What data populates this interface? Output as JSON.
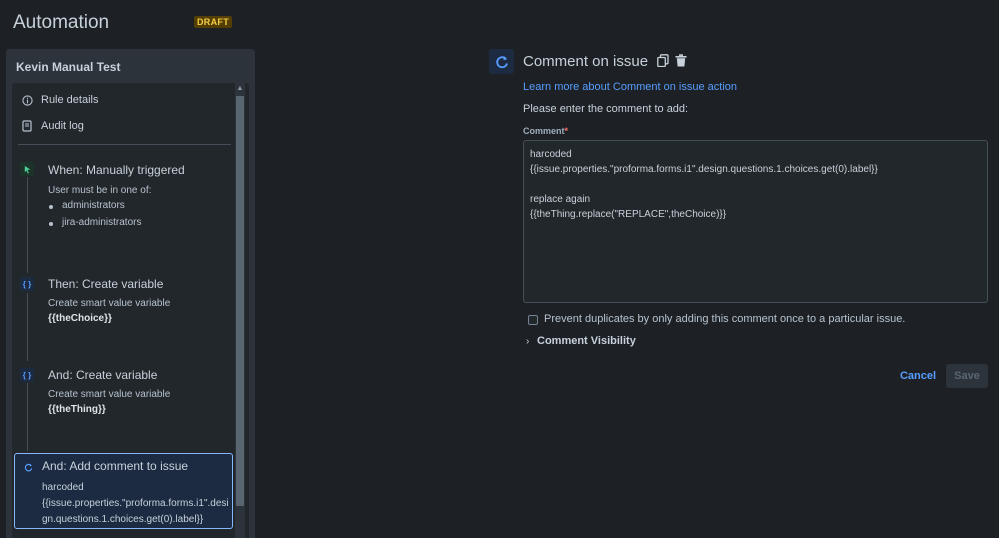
{
  "header": {
    "title": "Automation",
    "badge": "DRAFT"
  },
  "sidebar": {
    "rule_name": "Kevin Manual Test",
    "menu": [
      {
        "label": "Rule details",
        "icon": "info-icon"
      },
      {
        "label": "Audit log",
        "icon": "document-icon"
      }
    ],
    "steps": [
      {
        "title": "When: Manually triggered",
        "icon": "cursor-trigger-icon",
        "text": "User must be in one of:",
        "bullets": [
          "administrators",
          "jira-administrators"
        ]
      },
      {
        "title": "Then: Create variable",
        "icon": "braces-icon",
        "text": "Create smart value variable",
        "bold": "{{theChoice}}"
      },
      {
        "title": "And: Create variable",
        "icon": "braces-icon",
        "text": "Create smart value variable",
        "bold": "{{theThing}}"
      },
      {
        "title": "And: Add comment to issue",
        "icon": "comment-refresh-icon",
        "text": "harcoded\n{{issue.properties.\"proforma.forms.i1\".design.questions.1.choices.get(0).label}}"
      }
    ]
  },
  "detail": {
    "title": "Comment on issue",
    "learn_more": "Learn more about Comment on issue action",
    "prompt": "Please enter the comment to add:",
    "comment_label": "Comment",
    "required_marker": "*",
    "comment_value": "harcoded\n{{issue.properties.\"proforma.forms.i1\".design.questions.1.choices.get(0).label}}\n\nreplace again\n{{theThing.replace(\"REPLACE\",theChoice)}}",
    "prevent_duplicates_label": "Prevent duplicates by only adding this comment once to a particular issue.",
    "prevent_duplicates_checked": false,
    "visibility_label": "Comment Visibility",
    "cancel_label": "Cancel",
    "save_label": "Save"
  },
  "colors": {
    "background": "#1d2125",
    "accent": "#579dff",
    "draft_badge": "#f5cd47",
    "trigger_green": "#4bce97"
  }
}
